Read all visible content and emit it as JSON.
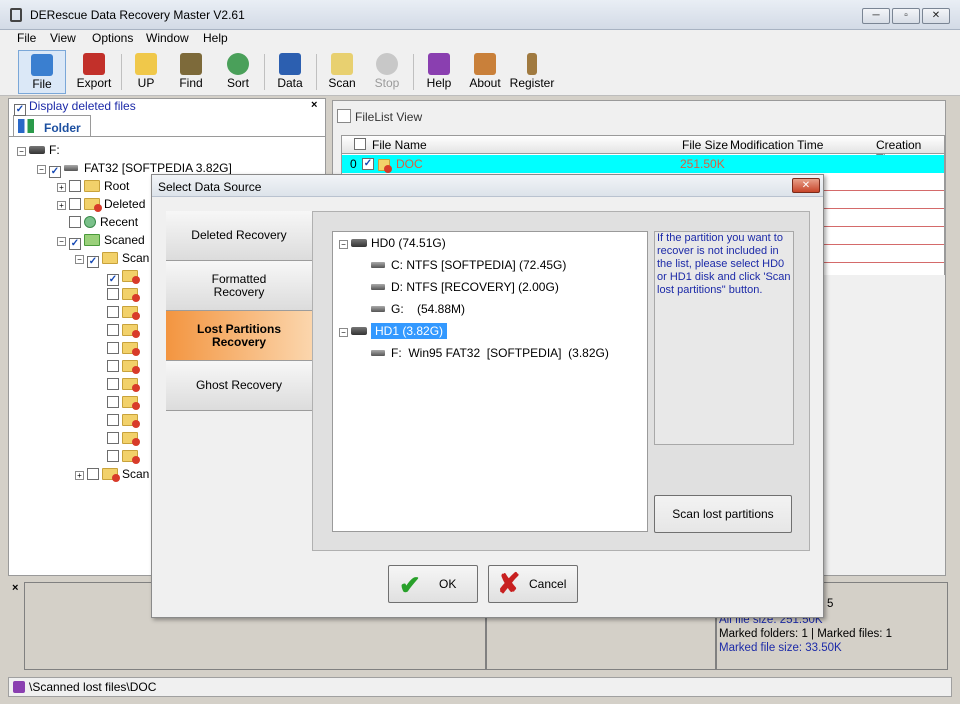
{
  "window": {
    "title": "DERescue Data Recovery Master V2.61",
    "controls": {
      "minimize": "─",
      "restore": "▫",
      "close": "✕"
    }
  },
  "menu": [
    "File",
    "View",
    "Options",
    "Window",
    "Help"
  ],
  "toolbar": {
    "file": "File",
    "export": "Export",
    "up": "UP",
    "find": "Find",
    "sort": "Sort",
    "data": "Data",
    "scan": "Scan",
    "stop": "Stop",
    "help": "Help",
    "about": "About",
    "register": "Register"
  },
  "left": {
    "display_deleted": "Display deleted files",
    "folder_tab": "Folder",
    "drive": "F:",
    "fat": "FAT32 [SOFTPEDIA 3.82G]",
    "root": "Root",
    "deleted": "Deleted",
    "recent": "Recent",
    "scaned": "Scaned",
    "scan_sub": "Scan",
    "scan_bottom": "Scan"
  },
  "filelist": {
    "title": "FileList View",
    "columns": [
      "File Name",
      "File Size",
      "Modification Time",
      "Creation Time"
    ],
    "row0": {
      "index": "0",
      "name": "DOC",
      "size": "251.50K"
    }
  },
  "bottom_info": {
    "all_size": "All file size: 251.50K",
    "marked": "Marked folders: 1  | Marked files: 1",
    "marked_size": "Marked file size: 33.50K",
    "partial": "5"
  },
  "status": {
    "path": "\\Scanned lost files\\DOC"
  },
  "dialog": {
    "title": "Select Data Source",
    "close": "✕",
    "tabs": [
      {
        "label": "Deleted Recovery"
      },
      {
        "label": "Formatted Recovery"
      },
      {
        "label": "Lost Partitions Recovery"
      },
      {
        "label": "Ghost Recovery"
      }
    ],
    "tree": {
      "hd0": "HD0  (74.51G)",
      "c": "C:  NTFS  [SOFTPEDIA]  (72.45G)",
      "d": "D:  NTFS  [RECOVERY]  (2.00G)",
      "g": "G:    (54.88M)",
      "hd1": "HD1  (3.82G)",
      "f": "F:  Win95 FAT32  [SOFTPEDIA]  (3.82G)"
    },
    "hint": "If the partition you want to recover is not included in the list, please select  HD0 or HD1 disk and click 'Scan lost partitions\" button.",
    "scan_button": "Scan lost partitions",
    "ok": "OK",
    "cancel": "Cancel"
  },
  "colors": {
    "accent_orange": "#f39540",
    "select_blue": "#3399ff",
    "row_cyan": "#00ffff",
    "link_blue": "#1c2aa8"
  }
}
